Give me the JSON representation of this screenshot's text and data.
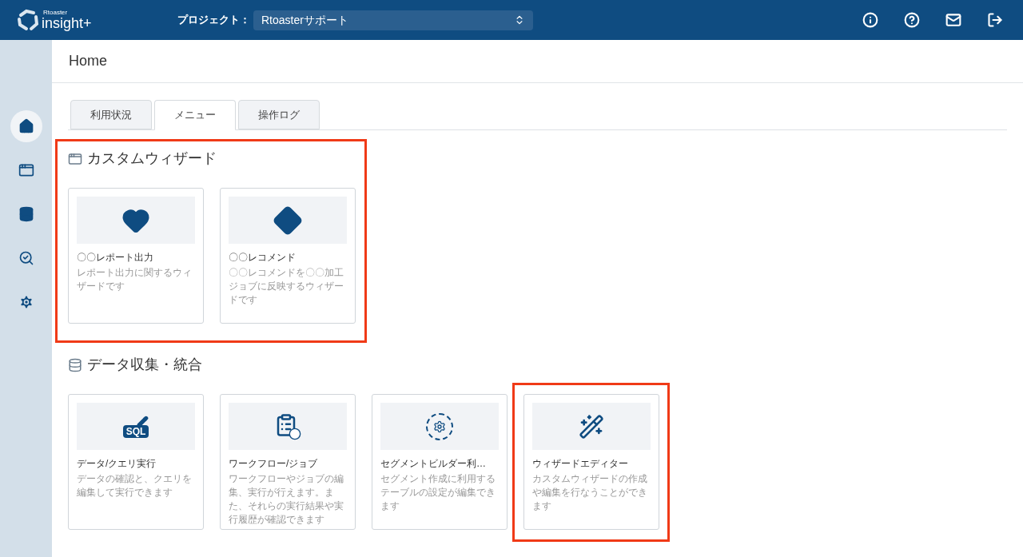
{
  "header": {
    "logo_small": "Rtoaster",
    "logo_main": "insight+",
    "project_label": "プロジェクト：",
    "project_value": "Rtoasterサポート"
  },
  "sidebar": {
    "items": [
      {
        "selected": true
      },
      {
        "selected": false
      },
      {
        "selected": false
      },
      {
        "selected": false
      },
      {
        "selected": false
      }
    ]
  },
  "page_title": "Home",
  "tabs": [
    {
      "label": "利用状況",
      "selected": false
    },
    {
      "label": "メニュー",
      "selected": true
    },
    {
      "label": "操作ログ",
      "selected": false
    }
  ],
  "sections": [
    {
      "title": "カスタムウィザード",
      "highlighted": true,
      "cards": [
        {
          "title": "〇〇レポート出力",
          "description": "レポート出力に関するウィザードです",
          "highlighted": false
        },
        {
          "title": "〇〇レコメンド",
          "description": "〇〇レコメンドを〇〇加工ジョブに反映するウィザードです",
          "highlighted": false
        }
      ]
    },
    {
      "title": "データ収集・統合",
      "highlighted": false,
      "cards": [
        {
          "title": "データ/クエリ実行",
          "description": "データの確認と、クエリを編集して実行できます",
          "highlighted": false,
          "icon_text": "SQL"
        },
        {
          "title": "ワークフロー/ジョブ",
          "description": "ワークフローやジョブの編集、実行が行えます。また、それらの実行結果や実行履歴が確認できます",
          "highlighted": false
        },
        {
          "title": "セグメントビルダー利…",
          "description": "セグメント作成に利用するテーブルの設定が編集できます",
          "highlighted": false
        },
        {
          "title": "ウィザードエディター",
          "description": "カスタムウィザードの作成や編集を行なうことができます",
          "highlighted": true
        }
      ]
    }
  ]
}
